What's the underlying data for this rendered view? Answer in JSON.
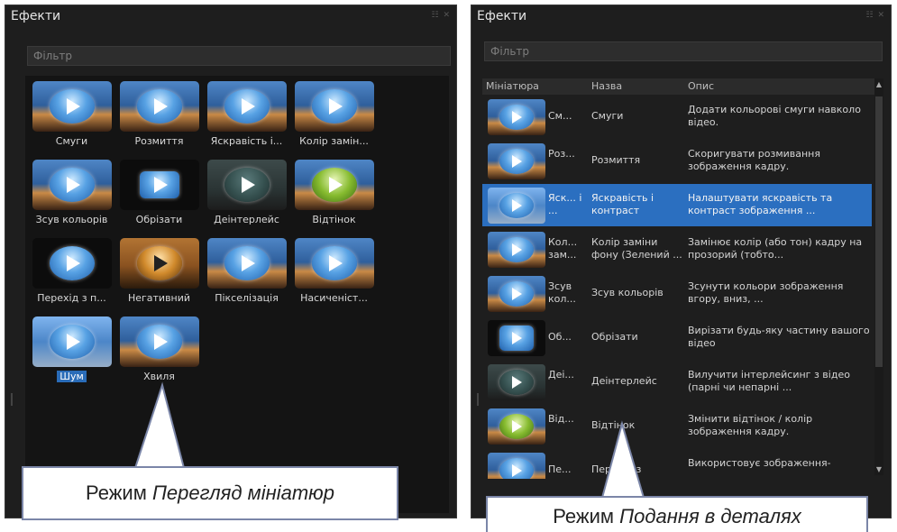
{
  "left_panel": {
    "title": "Ефекти",
    "controls": "☷ ✕",
    "filter_placeholder": "Фільтр",
    "tiles": [
      {
        "label": "Смуги",
        "icon": "stripes-effect-thumbnail"
      },
      {
        "label": "Розмиття",
        "icon": "blur-effect-thumbnail"
      },
      {
        "label": "Яскравість і...",
        "icon": "brightness-effect-thumbnail"
      },
      {
        "label": "Колір замін...",
        "icon": "chroma-key-effect-thumbnail"
      },
      {
        "label": "Зсув кольорів",
        "icon": "color-shift-effect-thumbnail"
      },
      {
        "label": "Обрізати",
        "icon": "crop-effect-thumbnail"
      },
      {
        "label": "Деінтерлейс",
        "icon": "deinterlace-effect-thumbnail"
      },
      {
        "label": "Відтінок",
        "icon": "hue-effect-thumbnail"
      },
      {
        "label": "Перехід з п...",
        "icon": "transition-effect-thumbnail"
      },
      {
        "label": "Негативний",
        "icon": "negative-effect-thumbnail"
      },
      {
        "label": "Пікселізація",
        "icon": "pixelate-effect-thumbnail"
      },
      {
        "label": "Насиченіст...",
        "icon": "saturation-effect-thumbnail"
      },
      {
        "label": "Шум",
        "icon": "noise-effect-thumbnail"
      },
      {
        "label": "Хвиля",
        "icon": "wave-effect-thumbnail"
      }
    ]
  },
  "right_panel": {
    "title": "Ефекти",
    "controls": "☷ ✕",
    "filter_placeholder": "Фільтр",
    "columns": [
      "Мініатюра",
      "Назва",
      "Опис"
    ],
    "rows": [
      {
        "short": "См...",
        "name": "Смуги",
        "desc": "Додати кольорові смуги навколо відео."
      },
      {
        "short": "Роз...",
        "name": "Розмиття",
        "desc": "Скоригувати розмивання зображення кадру."
      },
      {
        "short": "Яск... і ...",
        "name": "Яскравість і контраст",
        "desc": "Налаштувати яскравість та контраст зображення ..."
      },
      {
        "short": "Кол... зам...",
        "name": "Колір заміни фону (Зелений ...",
        "desc": "Замінює колір (або тон) кадру на прозорий (тобто..."
      },
      {
        "short": "Зсув кол...",
        "name": "Зсув кольорів",
        "desc": "Зсунути кольори зображення вгору, вниз, ..."
      },
      {
        "short": "Об...",
        "name": "Обрізати",
        "desc": "Вирізати будь-яку частину вашого відео"
      },
      {
        "short": "Деі...",
        "name": "Деінтерлейс",
        "desc": "Вилучити інтерлейсинг з відео (парні чи непарні ..."
      },
      {
        "short": "Від...",
        "name": "Відтінок",
        "desc": "Змінити відтінок / колір зображення кадру."
      },
      {
        "short": "Пе...",
        "name": "Перехід з",
        "desc": "Використовує зображення-"
      }
    ]
  },
  "callouts": {
    "left_prefix": "Режим ",
    "left_mode": "Перегляд мініатюр",
    "right_prefix": "Режим ",
    "right_mode": "Подання в деталях"
  },
  "colors": {
    "panel_bg": "#1e1e1e",
    "selection": "#2b6fc0",
    "callout_border": "#7b86a8"
  }
}
